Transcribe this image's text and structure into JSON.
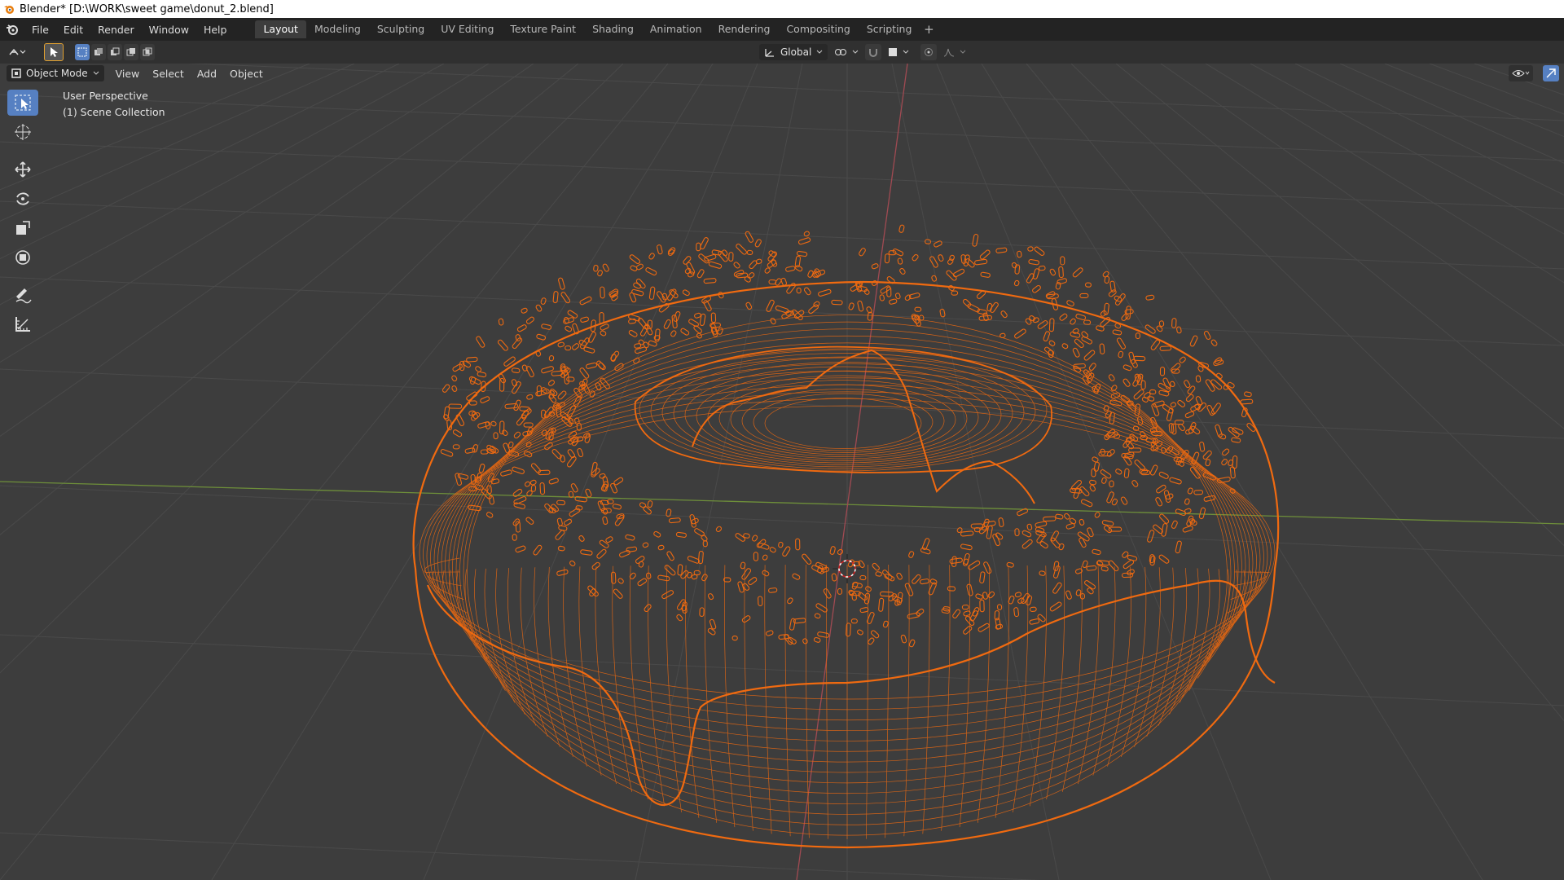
{
  "window": {
    "title": "Blender* [D:\\WORK\\sweet game\\donut_2.blend]"
  },
  "menu": [
    "File",
    "Edit",
    "Render",
    "Window",
    "Help"
  ],
  "workspaces": [
    {
      "label": "Layout",
      "active": true
    },
    {
      "label": "Modeling",
      "active": false
    },
    {
      "label": "Sculpting",
      "active": false
    },
    {
      "label": "UV Editing",
      "active": false
    },
    {
      "label": "Texture Paint",
      "active": false
    },
    {
      "label": "Shading",
      "active": false
    },
    {
      "label": "Animation",
      "active": false
    },
    {
      "label": "Rendering",
      "active": false
    },
    {
      "label": "Compositing",
      "active": false
    },
    {
      "label": "Scripting",
      "active": false
    }
  ],
  "tool_header": {
    "transform_orientation": "Global"
  },
  "viewport_header": {
    "mode": "Object Mode",
    "menus": [
      "View",
      "Select",
      "Add",
      "Object"
    ]
  },
  "viewport": {
    "perspective_label": "User Perspective",
    "collection_label": "(1) Scene Collection"
  },
  "colors": {
    "selection_orange": "#f06a10",
    "active_tool_blue": "#5680c2",
    "x_axis_red": "#a04a52",
    "y_axis_green": "#6e8f3a",
    "grid": "#474747"
  }
}
